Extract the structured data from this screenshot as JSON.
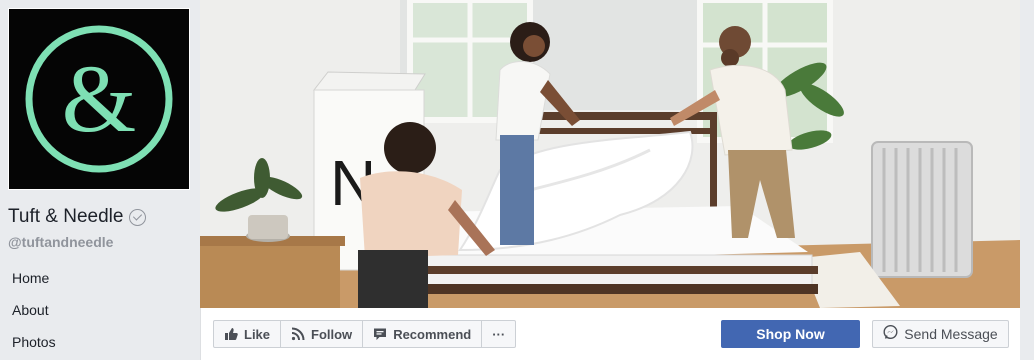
{
  "page": {
    "name": "Tuft & Needle",
    "handle": "@tuftandneedle",
    "verified": true
  },
  "nav": {
    "items": [
      {
        "label": "Home"
      },
      {
        "label": "About"
      },
      {
        "label": "Photos"
      }
    ]
  },
  "actions": {
    "like_label": "Like",
    "follow_label": "Follow",
    "recommend_label": "Recommend",
    "more_label": "···",
    "shop_label": "Shop Now",
    "message_label": "Send Message"
  },
  "colors": {
    "brand_mint": "#7ee0b4",
    "logo_background": "#050505",
    "primary_button": "#4267b2",
    "page_background": "#e9ebee"
  },
  "icons": {
    "like": "thumbs-up-icon",
    "follow": "rss-icon",
    "recommend": "speech-bubble-icon",
    "message": "messenger-icon",
    "verified": "verified-check-icon"
  }
}
